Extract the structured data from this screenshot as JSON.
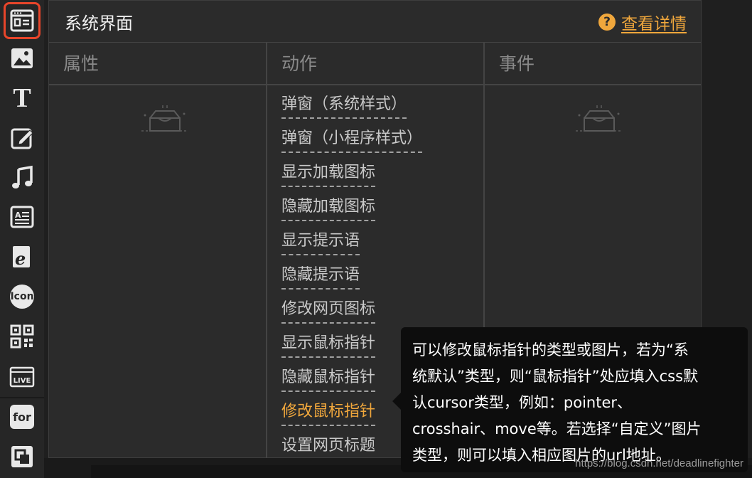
{
  "panel": {
    "title": "系统界面",
    "help_label": "查看详情",
    "help_icon": "?"
  },
  "columns": {
    "properties": "属性",
    "actions": "动作",
    "events": "事件"
  },
  "actions": [
    {
      "label": "弹窗（系统样式）",
      "active": false
    },
    {
      "label": "弹窗（小程序样式）",
      "active": false
    },
    {
      "label": "显示加载图标",
      "active": false
    },
    {
      "label": "隐藏加载图标",
      "active": false
    },
    {
      "label": "显示提示语",
      "active": false
    },
    {
      "label": "隐藏提示语",
      "active": false
    },
    {
      "label": "修改网页图标",
      "active": false
    },
    {
      "label": "显示鼠标指针",
      "active": false
    },
    {
      "label": "隐藏鼠标指针",
      "active": false
    },
    {
      "label": "修改鼠标指针",
      "active": true
    },
    {
      "label": "设置网页标题",
      "active": false
    }
  ],
  "toolbar": {
    "icon_label": "Icon",
    "for_label": "for",
    "live_label": "LIVE",
    "text_tool_glyph": "T"
  },
  "tooltip": {
    "lines": [
      "可以修改鼠标指针的类型或图片，若为“系",
      "统默认”类型，则“鼠标指针”处应填入css默",
      "认cursor类型，例如：pointer、",
      "crosshair、move等。若选择“自定义”图片",
      "类型，则可以填入相应图片的url地址。"
    ]
  },
  "watermark": "https://blog.csdn.net/deadlinefighter",
  "colors": {
    "accent": "#f0a73c",
    "selected_border": "#e8452a",
    "panel_bg": "#2b2b2b"
  }
}
